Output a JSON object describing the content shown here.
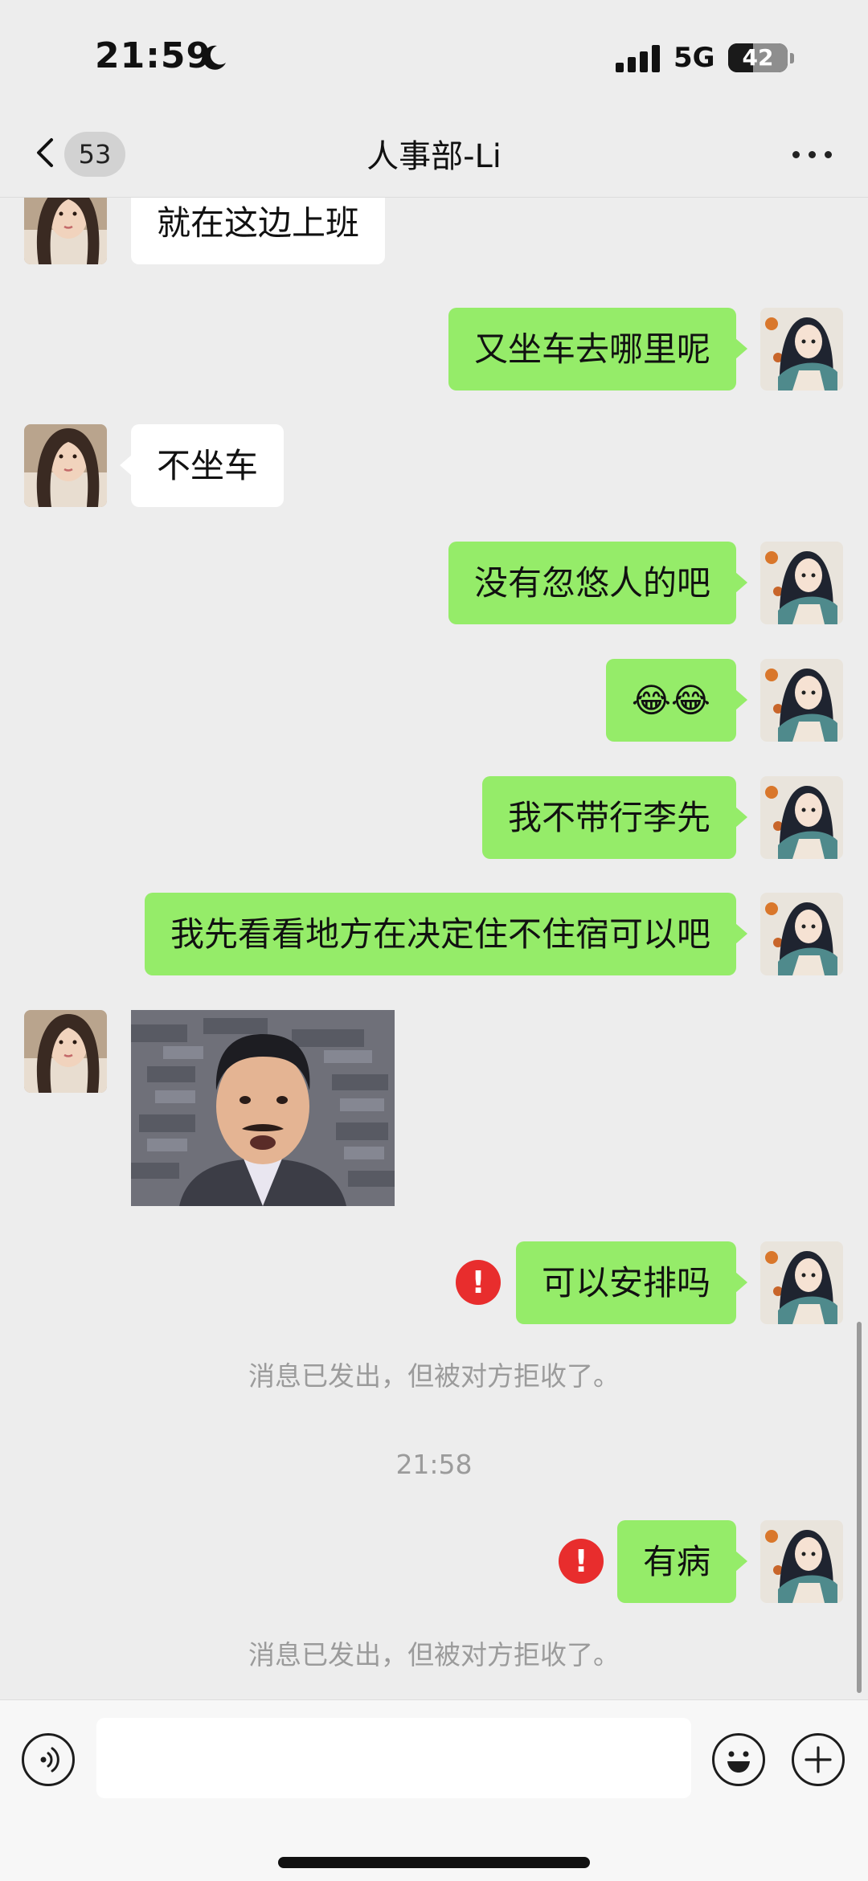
{
  "status_bar": {
    "time": "21:59",
    "network": "5G",
    "battery": "42",
    "battery_level_percent": 42
  },
  "nav": {
    "unread_count": "53",
    "title": "人事部-Li"
  },
  "messages": {
    "m1": "就在这边上班",
    "m2": "又坐车去哪里呢",
    "m3": "不坐车",
    "m4": "没有忽悠人的吧",
    "m5": "😂😂",
    "m6": "我不带行李先",
    "m7": "我先看看地方在决定住不住宿可以吧",
    "m9": "可以安排吗",
    "m10": "有病",
    "error_mark": "!"
  },
  "system": {
    "rejected_1": "消息已发出，但被对方拒收了。",
    "timestamp": "21:58",
    "rejected_2": "消息已发出，但被对方拒收了。"
  },
  "input": {
    "placeholder": ""
  },
  "colors": {
    "outgoing_bubble": "#95ec69",
    "incoming_bubble": "#ffffff",
    "error": "#e82d2d",
    "background": "#ededed"
  },
  "icons": {
    "moon": "moon-icon",
    "signal": "signal-icon",
    "back": "chevron-left-icon",
    "more": "more-icon",
    "voice": "voice-icon",
    "emoji": "emoji-icon",
    "add": "plus-icon"
  }
}
